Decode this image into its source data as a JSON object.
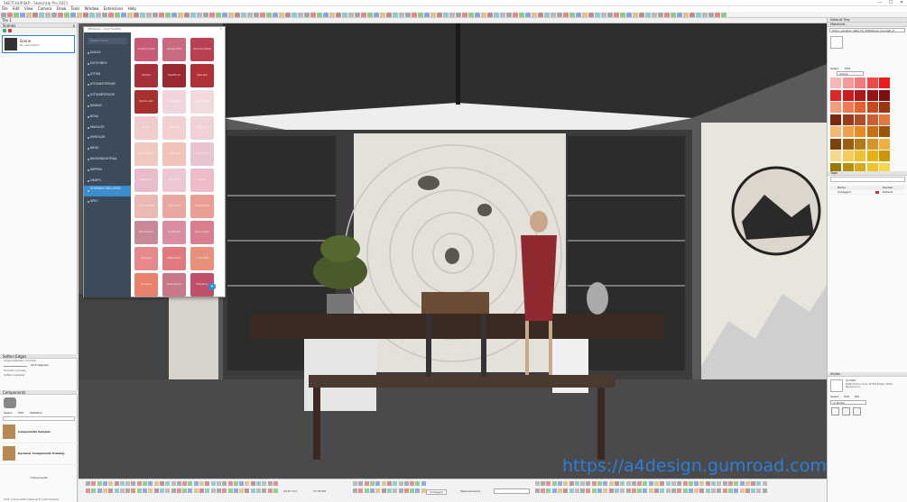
{
  "window": {
    "title": "SKETCHUP.SKP - SketchUp Pro 2021",
    "min_glyph": "—",
    "max_glyph": "☐",
    "close_glyph": "✕"
  },
  "menu": [
    "File",
    "Edit",
    "View",
    "Camera",
    "Draw",
    "Tools",
    "Window",
    "Extensions",
    "Help"
  ],
  "document_tab": "Tile 1",
  "left_tray": {
    "scenes": {
      "title": "Scenes",
      "close_glyph": "x",
      "items": [
        {
          "name": "Scene",
          "desc": "No description"
        }
      ]
    },
    "soften_edges": {
      "title": "Soften Edges",
      "angle_label": "Angle between normals:",
      "angle_value": "20.0 degrees",
      "options": [
        "Smooth normals",
        "Soften coplanar"
      ]
    },
    "components": {
      "title": "Components",
      "tabs": [
        "Select",
        "Edit",
        "Statistics"
      ],
      "items": [
        {
          "name": "Components Sampler"
        },
        {
          "name": "Dynamic Components Training"
        }
      ],
      "footer": "Components"
    },
    "status_hint": "Click a face with material to pick texture."
  },
  "color_picker": {
    "title": "4DDesign - Color Palette",
    "search_placeholder": "Search colors...",
    "brands": [
      {
        "label": "DULUX"
      },
      {
        "label": "DUTCHBOY"
      },
      {
        "label": "JOTOM"
      },
      {
        "label": "JOTUNEXTERIOR"
      },
      {
        "label": "JOTUNINTERIOR"
      },
      {
        "label": "KANSAI"
      },
      {
        "label": "KOVA"
      },
      {
        "label": "MAXILITE"
      },
      {
        "label": "MYKOLOR"
      },
      {
        "label": "NEXO"
      },
      {
        "label": "NEXOINDUSTRIAL"
      },
      {
        "label": "NIPPON"
      },
      {
        "label": "OKAPO"
      },
      {
        "label": "SHERWIN WILLIAMS"
      },
      {
        "label": "SPEC"
      }
    ],
    "swatches": [
      {
        "name": "Cranberry Pink",
        "color": "#c85a78"
      },
      {
        "name": "Antique Pink",
        "color": "#c86a80"
      },
      {
        "name": "Cherries Jubilee",
        "color": "#b84050"
      },
      {
        "name": "Radiant",
        "color": "#a8303a"
      },
      {
        "name": "Heartthrob",
        "color": "#9a2a32"
      },
      {
        "name": "Real Red",
        "color": "#b23038"
      },
      {
        "name": "Fashion Red",
        "color": "#a6302e"
      },
      {
        "name": "Petal Tip",
        "color": "#f0d6dc"
      },
      {
        "name": "Rose Water",
        "color": "#f2dadd"
      },
      {
        "name": "Blush",
        "color": "#f0cccc"
      },
      {
        "name": "Pink Mist",
        "color": "#f2d0d0"
      },
      {
        "name": "Shell Pink",
        "color": "#f0d2d6"
      },
      {
        "name": "Peach Cream",
        "color": "#f0c8c0"
      },
      {
        "name": "Coral Sand",
        "color": "#f0c2b8"
      },
      {
        "name": "Orchid Tint",
        "color": "#e8c4d0"
      },
      {
        "name": "Sweet Pea",
        "color": "#e8bccc"
      },
      {
        "name": "Fairy Rose",
        "color": "#ecc6d0"
      },
      {
        "name": "Candy",
        "color": "#eebcc8"
      },
      {
        "name": "Apricot Blush",
        "color": "#ecb8b2"
      },
      {
        "name": "Coral Glow",
        "color": "#e8a8a0"
      },
      {
        "name": "Salmon Pink",
        "color": "#ea9e92"
      },
      {
        "name": "Mauve Rose",
        "color": "#c88898"
      },
      {
        "name": "Dusty Pink",
        "color": "#d88ea0"
      },
      {
        "name": "Rosy Cheek",
        "color": "#d87e8e"
      },
      {
        "name": "Flamingo",
        "color": "#e6888c"
      },
      {
        "name": "Watermelon",
        "color": "#e07a7e"
      },
      {
        "name": "Coral Reef",
        "color": "#e8907c"
      },
      {
        "name": "Tangerine",
        "color": "#e8806c"
      },
      {
        "name": "Rose Quartz",
        "color": "#c87888"
      },
      {
        "name": "Raspberry",
        "color": "#c0506a"
      }
    ],
    "fab_glyph": "+"
  },
  "right_tray": {
    "default_tray": "Default Tray",
    "materials": {
      "title": "Materials",
      "current": "Tranc_Ceramic_Wall_01_3Dtexture_Concept_P_",
      "tabs": [
        "Select",
        "Edit"
      ],
      "library": "Colors"
    },
    "material_grid": [
      [
        "#f7b6b6",
        "#f59a9a",
        "#f27a7a",
        "#ee4a4a",
        "#e81e1e"
      ],
      [
        "#d82828",
        "#c81e1e",
        "#b01818",
        "#981414",
        "#7a1010"
      ],
      [
        "#f59a7a",
        "#f07a55",
        "#e8602e",
        "#c84a1e",
        "#9a3612"
      ],
      [
        "#7a2810",
        "#9a3c1e",
        "#b04e28",
        "#c86034",
        "#e07840"
      ],
      [
        "#f5b874",
        "#f0a04a",
        "#e88a20",
        "#c87010",
        "#9a5608"
      ],
      [
        "#7a4408",
        "#9a6010",
        "#b87a18",
        "#d89428",
        "#f0b040"
      ],
      [
        "#f5d88a",
        "#f5cc5a",
        "#f0c030",
        "#e8b010",
        "#c89608"
      ],
      [
        "#9a7808",
        "#b89010",
        "#d8aa18",
        "#f0c428",
        "#f5d650"
      ]
    ],
    "tags": {
      "title": "Tags",
      "columns": [
        "Name",
        "Dashes"
      ],
      "rows": [
        {
          "name": "Untagged",
          "dashes": "Default"
        }
      ]
    },
    "styles": {
      "title": "Styles",
      "name": "Arch4D",
      "desc": "Default face colors. Profile Edges. White Background."
    },
    "styles_tabs": [
      "Select",
      "Edit",
      "Mix"
    ],
    "style_library": "In Model"
  },
  "statusbar": {
    "measurements_label": "Measurements",
    "value_a": "29.57 mm",
    "value_b": "37.33 PM",
    "tag": "Untagged"
  },
  "watermark": "https://a4design.gumroad.com",
  "colors": {
    "accent": "#3a8ed0",
    "sidebar": "#3b4b5a",
    "watermark": "#2b7fd6"
  }
}
